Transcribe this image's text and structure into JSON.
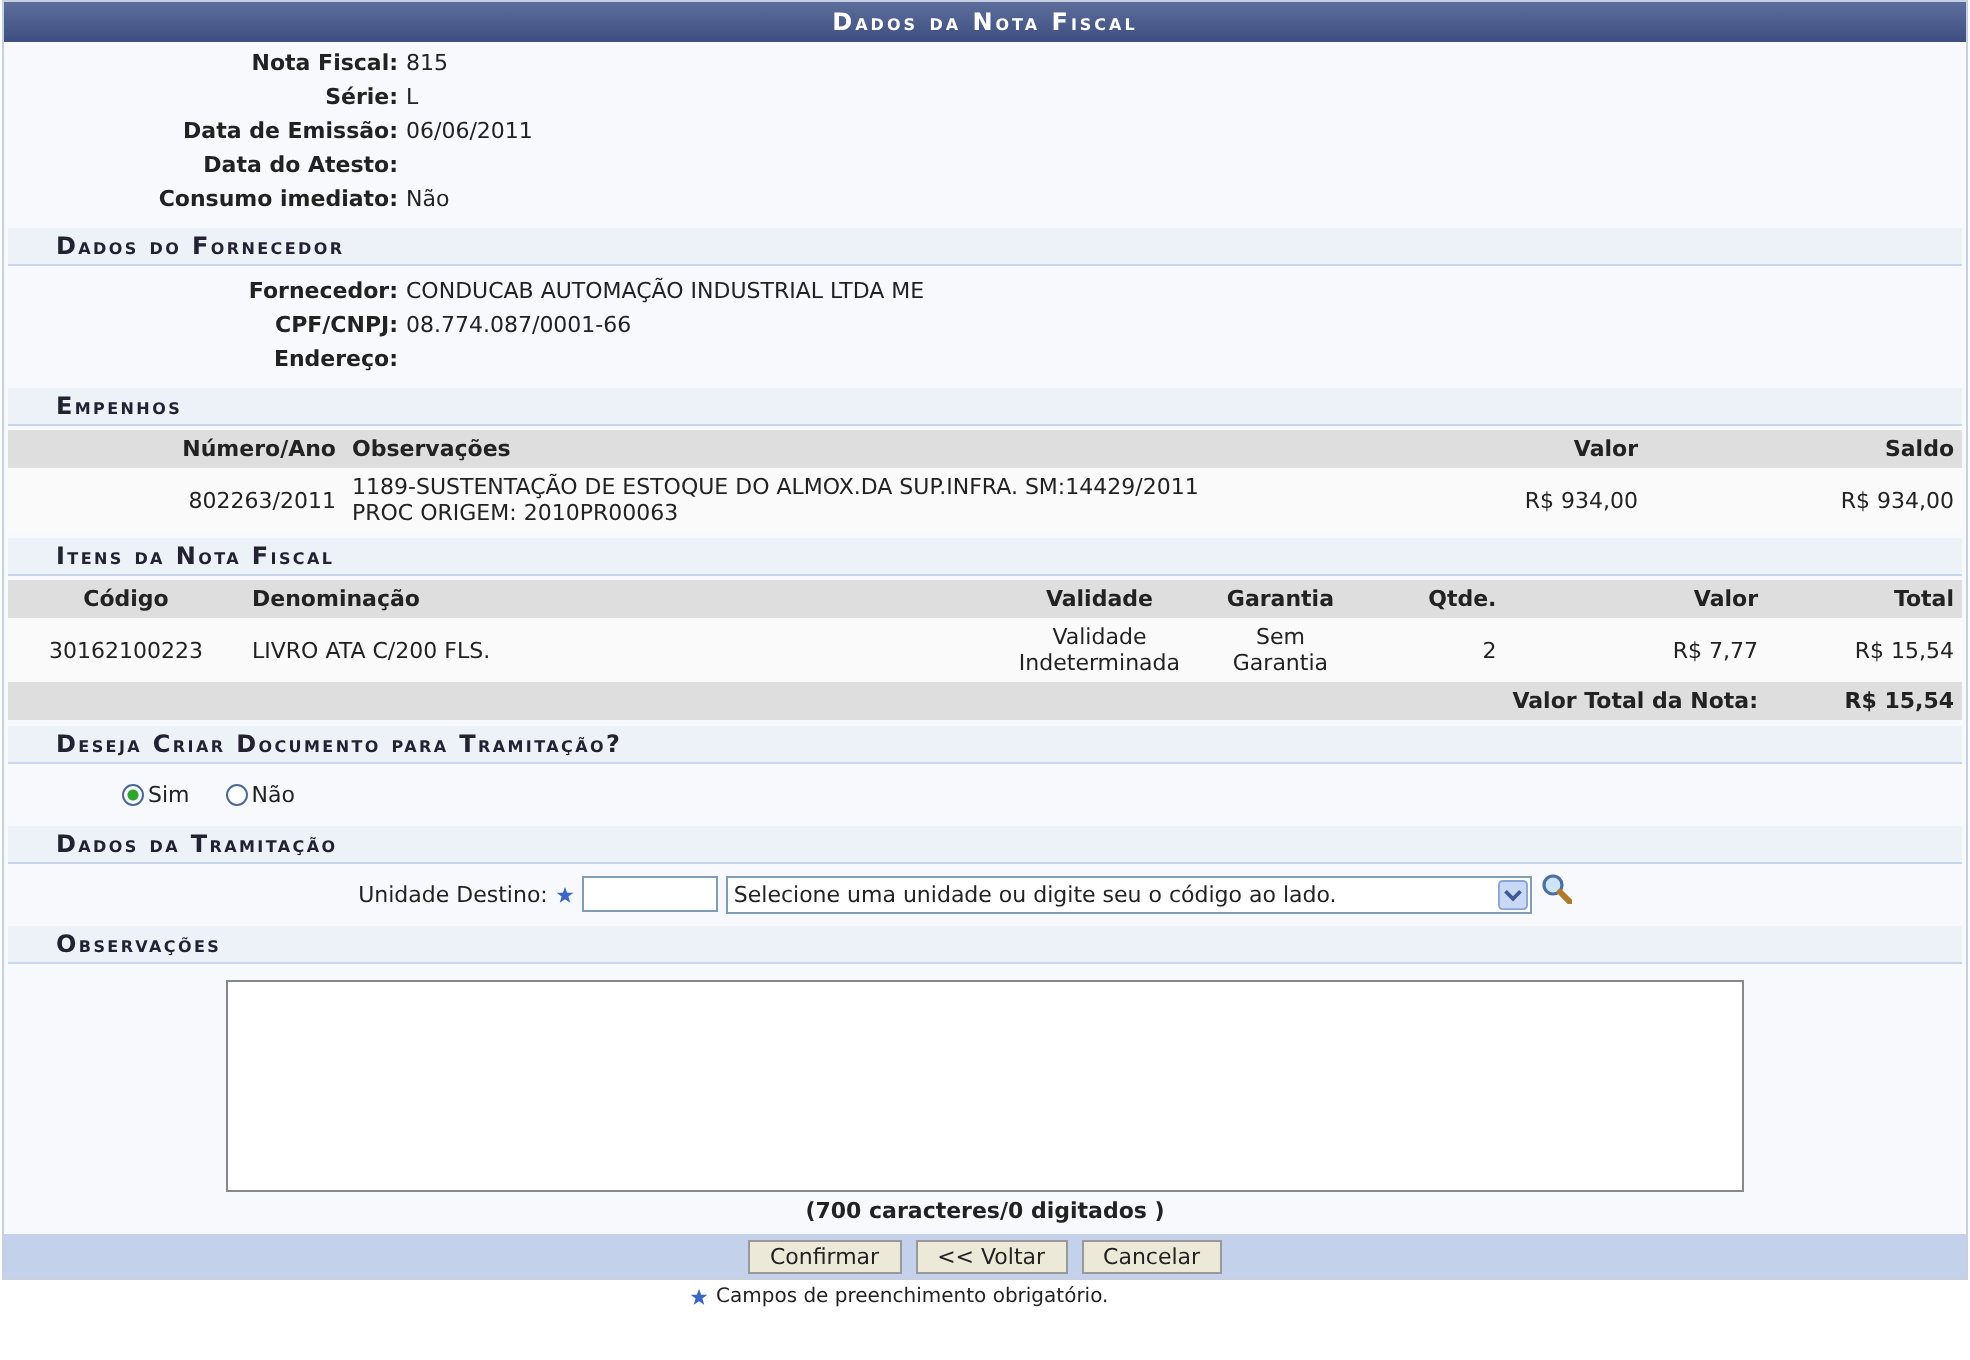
{
  "title": "Dados da Nota Fiscal",
  "nota": [
    {
      "label": "Nota Fiscal:",
      "value": "815"
    },
    {
      "label": "Série:",
      "value": "L"
    },
    {
      "label": "Data de Emissão:",
      "value": "06/06/2011"
    },
    {
      "label": "Data do Atesto:"
    },
    {
      "label": "Consumo imediato:",
      "value": "Não"
    }
  ],
  "fornecedor": {
    "heading": "Dados do Fornecedor",
    "fields": [
      {
        "label": "Fornecedor:",
        "value": "CONDUCAB AUTOMAÇÃO INDUSTRIAL LTDA ME"
      },
      {
        "label": "CPF/CNPJ:",
        "value": "08.774.087/0001-66"
      },
      {
        "label": "Endereço:"
      }
    ]
  },
  "empenhos": {
    "heading": "Empenhos",
    "columns": [
      "Número/Ano",
      "Observações",
      "Valor",
      "Saldo"
    ],
    "rows": [
      {
        "numero": "802263/2011",
        "observacoes": [
          "1189-SUSTENTAÇÃO DE ESTOQUE DO ALMOX.DA SUP.INFRA. SM:14429/2011",
          "PROC ORIGEM: 2010PR00063"
        ],
        "valor": "R$ 934,00",
        "saldo": "R$ 934,00"
      }
    ]
  },
  "itens": {
    "heading": "Itens da Nota Fiscal",
    "columns": [
      "Código",
      "Denominação",
      "Validade",
      "Garantia",
      "Qtde.",
      "Valor",
      "Total"
    ],
    "rows": [
      {
        "codigo": "30162100223",
        "denominacao": "LIVRO ATA C/200 FLS.",
        "validade": [
          "Validade",
          "Indeterminada"
        ],
        "garantia": [
          "Sem",
          "Garantia"
        ],
        "qtde": "2",
        "valor": "R$ 7,77",
        "total": "R$ 15,54"
      }
    ],
    "total_label": "Valor Total da Nota:",
    "total_value": "R$ 15,54"
  },
  "criar_documento": {
    "heading": "Deseja Criar Documento para Tramitação?",
    "options": [
      {
        "label": "Sim",
        "selected": true
      },
      {
        "label": "Não",
        "selected": false
      }
    ]
  },
  "tramitacao": {
    "heading": "Dados da Tramitação",
    "label": "Unidade Destino:",
    "select_value": "Selecione uma unidade ou digite seu o código ao lado."
  },
  "observacoes": {
    "heading": "Observações",
    "counter": "(700 caracteres/0 digitados )"
  },
  "buttons": [
    "Confirmar",
    "<< Voltar",
    "Cancelar"
  ],
  "footnote": "Campos de preenchimento obrigatório."
}
